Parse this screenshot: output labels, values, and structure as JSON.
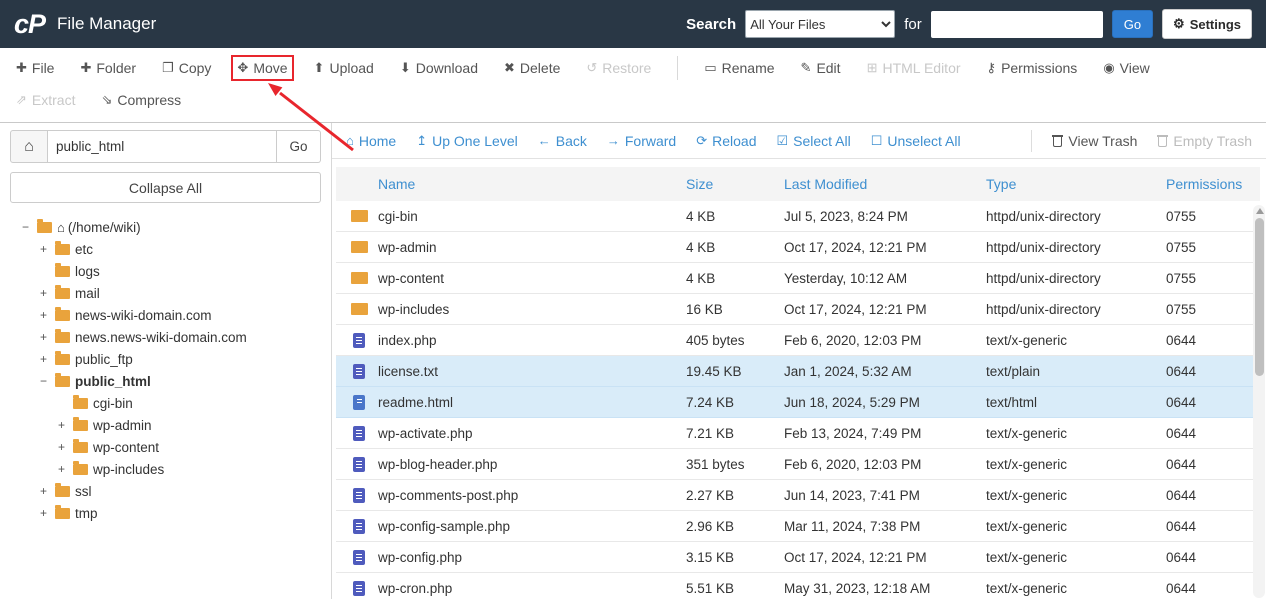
{
  "colors": {
    "header_bg": "#293745",
    "accent_blue": "#2f7ed3",
    "link_blue": "#3e8fd0",
    "folder_orange": "#e9a33c",
    "file_indigo": "#4f5bbd",
    "selected_row_bg": "#d9ecf9",
    "annotation_red": "#e8262d"
  },
  "icons": {
    "gear": "⚙",
    "home": "⌂"
  },
  "header": {
    "logo": "cP",
    "title": "File Manager",
    "search_label": "Search",
    "search_scope_selected": "All Your Files",
    "for_label": "for",
    "search_value": "",
    "go_label": "Go",
    "settings_label": "Settings"
  },
  "toolbar": {
    "row1": [
      {
        "label": "File",
        "icon": "file-plus-icon",
        "glyph": "✚",
        "enabled": true
      },
      {
        "label": "Folder",
        "icon": "folder-plus-icon",
        "glyph": "✚",
        "enabled": true
      },
      {
        "label": "Copy",
        "icon": "copy-icon",
        "glyph": "❐",
        "enabled": true
      },
      {
        "label": "Move",
        "icon": "move-icon",
        "glyph": "✥",
        "enabled": true,
        "annotated": true
      },
      {
        "label": "Upload",
        "icon": "upload-icon",
        "glyph": "⬆",
        "enabled": true
      },
      {
        "label": "Download",
        "icon": "download-icon",
        "glyph": "⬇",
        "enabled": true
      },
      {
        "label": "Delete",
        "icon": "delete-icon",
        "glyph": "✖",
        "enabled": true
      },
      {
        "label": "Restore",
        "icon": "restore-icon",
        "glyph": "↺",
        "enabled": false
      },
      {
        "separator": true
      },
      {
        "label": "Rename",
        "icon": "rename-icon",
        "glyph": "▭",
        "enabled": true
      },
      {
        "label": "Edit",
        "icon": "edit-pencil-icon",
        "glyph": "✎",
        "enabled": true
      },
      {
        "label": "HTML Editor",
        "icon": "html-editor-icon",
        "glyph": "⊞",
        "enabled": false
      },
      {
        "label": "Permissions",
        "icon": "permissions-key-icon",
        "glyph": "⚷",
        "enabled": true
      },
      {
        "label": "View",
        "icon": "view-eye-icon",
        "glyph": "◉",
        "enabled": true
      }
    ],
    "row2": [
      {
        "label": "Extract",
        "icon": "extract-icon",
        "glyph": "⇗",
        "enabled": false
      },
      {
        "label": "Compress",
        "icon": "compress-icon",
        "glyph": "⇘",
        "enabled": true
      }
    ]
  },
  "sidebar": {
    "path_value": "public_html",
    "go_label": "Go",
    "collapse_all_label": "Collapse All",
    "tree": [
      {
        "label": "(/home/wiki)",
        "expander": "−",
        "level": 0,
        "home": true,
        "open": true
      },
      {
        "label": "etc",
        "expander": "+",
        "level": 1
      },
      {
        "label": "logs",
        "expander": "",
        "level": 1
      },
      {
        "label": "mail",
        "expander": "+",
        "level": 1
      },
      {
        "label": "news-wiki-domain.com",
        "expander": "+",
        "level": 1
      },
      {
        "label": "news.news-wiki-domain.com",
        "expander": "+",
        "level": 1
      },
      {
        "label": "public_ftp",
        "expander": "+",
        "level": 1
      },
      {
        "label": "public_html",
        "expander": "−",
        "level": 1,
        "bold": true,
        "open": true
      },
      {
        "label": "cgi-bin",
        "expander": "",
        "level": 2
      },
      {
        "label": "wp-admin",
        "expander": "+",
        "level": 2
      },
      {
        "label": "wp-content",
        "expander": "+",
        "level": 2
      },
      {
        "label": "wp-includes",
        "expander": "+",
        "level": 2
      },
      {
        "label": "ssl",
        "expander": "+",
        "level": 1
      },
      {
        "label": "tmp",
        "expander": "+",
        "level": 1
      }
    ]
  },
  "filenav": {
    "items": [
      {
        "label": "Home",
        "icon": "home-icon",
        "glyph": "⌂",
        "style": "link"
      },
      {
        "label": "Up One Level",
        "icon": "up-one-level-icon",
        "glyph": "↥",
        "style": "link"
      },
      {
        "label": "Back",
        "icon": "back-arrow-icon",
        "glyph": "←",
        "style": "link"
      },
      {
        "label": "Forward",
        "icon": "forward-arrow-icon",
        "glyph": "→",
        "style": "link"
      },
      {
        "label": "Reload",
        "icon": "reload-icon",
        "glyph": "⟳",
        "style": "link"
      },
      {
        "label": "Select All",
        "icon": "select-all-icon",
        "glyph": "☑",
        "style": "link"
      },
      {
        "label": "Unselect All",
        "icon": "unselect-all-icon",
        "glyph": "☐",
        "style": "link"
      },
      {
        "separator": true
      },
      {
        "label": "View Trash",
        "icon": "view-trash-icon",
        "css_icon": "trash",
        "style": "muted"
      },
      {
        "label": "Empty Trash",
        "icon": "empty-trash-icon",
        "css_icon": "trash",
        "style": "disabled"
      }
    ]
  },
  "files": {
    "columns": [
      "Name",
      "Size",
      "Last Modified",
      "Type",
      "Permissions"
    ],
    "rows": [
      {
        "icon": "folder",
        "name": "cgi-bin",
        "size": "4 KB",
        "modified": "Jul 5, 2023, 8:24 PM",
        "type": "httpd/unix-directory",
        "perms": "0755",
        "selected": false
      },
      {
        "icon": "folder",
        "name": "wp-admin",
        "size": "4 KB",
        "modified": "Oct 17, 2024, 12:21 PM",
        "type": "httpd/unix-directory",
        "perms": "0755",
        "selected": false
      },
      {
        "icon": "folder",
        "name": "wp-content",
        "size": "4 KB",
        "modified": "Yesterday, 10:12 AM",
        "type": "httpd/unix-directory",
        "perms": "0755",
        "selected": false
      },
      {
        "icon": "folder",
        "name": "wp-includes",
        "size": "16 KB",
        "modified": "Oct 17, 2024, 12:21 PM",
        "type": "httpd/unix-directory",
        "perms": "0755",
        "selected": false
      },
      {
        "icon": "file",
        "name": "index.php",
        "size": "405 bytes",
        "modified": "Feb 6, 2020, 12:03 PM",
        "type": "text/x-generic",
        "perms": "0644",
        "selected": false
      },
      {
        "icon": "file",
        "name": "license.txt",
        "size": "19.45 KB",
        "modified": "Jan 1, 2024, 5:32 AM",
        "type": "text/plain",
        "perms": "0644",
        "selected": true
      },
      {
        "icon": "file-html",
        "name": "readme.html",
        "size": "7.24 KB",
        "modified": "Jun 18, 2024, 5:29 PM",
        "type": "text/html",
        "perms": "0644",
        "selected": true
      },
      {
        "icon": "file",
        "name": "wp-activate.php",
        "size": "7.21 KB",
        "modified": "Feb 13, 2024, 7:49 PM",
        "type": "text/x-generic",
        "perms": "0644",
        "selected": false
      },
      {
        "icon": "file",
        "name": "wp-blog-header.php",
        "size": "351 bytes",
        "modified": "Feb 6, 2020, 12:03 PM",
        "type": "text/x-generic",
        "perms": "0644",
        "selected": false
      },
      {
        "icon": "file",
        "name": "wp-comments-post.php",
        "size": "2.27 KB",
        "modified": "Jun 14, 2023, 7:41 PM",
        "type": "text/x-generic",
        "perms": "0644",
        "selected": false
      },
      {
        "icon": "file",
        "name": "wp-config-sample.php",
        "size": "2.96 KB",
        "modified": "Mar 11, 2024, 7:38 PM",
        "type": "text/x-generic",
        "perms": "0644",
        "selected": false
      },
      {
        "icon": "file",
        "name": "wp-config.php",
        "size": "3.15 KB",
        "modified": "Oct 17, 2024, 12:21 PM",
        "type": "text/x-generic",
        "perms": "0644",
        "selected": false
      },
      {
        "icon": "file",
        "name": "wp-cron.php",
        "size": "5.51 KB",
        "modified": "May 31, 2023, 12:18 AM",
        "type": "text/x-generic",
        "perms": "0644",
        "selected": false
      }
    ]
  }
}
